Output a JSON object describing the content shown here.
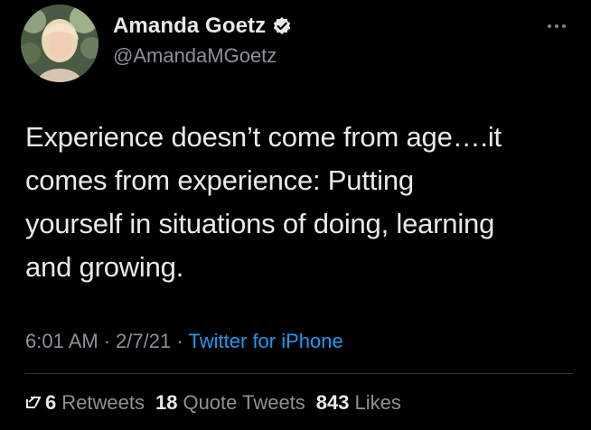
{
  "tweet": {
    "author": {
      "display_name": "Amanda Goetz",
      "handle": "@AmandaMGoetz",
      "verified_icon": "verified-badge-icon"
    },
    "more_icon": "more-options-icon",
    "text_lines": [
      "Experience doesn’t come from age….it",
      "comes from experience: Putting",
      "yourself in situations of doing, learning",
      "and growing."
    ],
    "meta": {
      "time": "6:01 AM",
      "separator": "·",
      "date": "2/7/21",
      "source": "Twitter for iPhone"
    },
    "stats": {
      "retweets_count_fragment": "6",
      "retweets_label": "Retweets",
      "quote_tweets_count": "18",
      "quote_tweets_label": "Quote Tweets",
      "likes_count": "843",
      "likes_label": "Likes"
    },
    "colors": {
      "background": "#000000",
      "primary_text": "#e7e9ea",
      "secondary_text": "#8b9197",
      "link": "#1d9bf0",
      "divider": "#2f3336"
    }
  }
}
